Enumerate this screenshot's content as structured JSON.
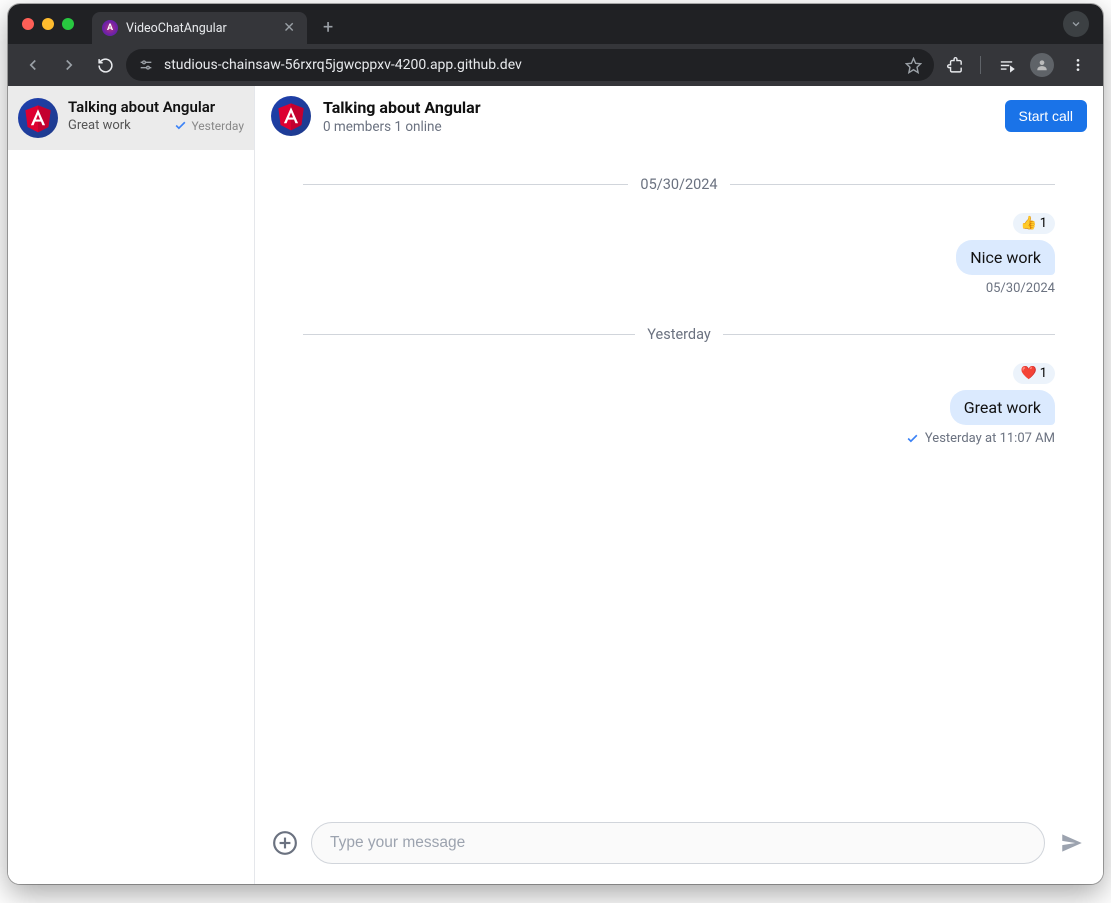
{
  "browser": {
    "tab_title": "VideoChatAngular",
    "url": "studious-chainsaw-56rxrq5jgwcppxv-4200.app.github.dev"
  },
  "sidebar": {
    "channel": {
      "name": "Talking about Angular",
      "preview": "Great work",
      "timestamp": "Yesterday"
    }
  },
  "header": {
    "title": "Talking about Angular",
    "subtitle": "0 members 1 online",
    "call_button": "Start call"
  },
  "messages": {
    "sep1": "05/30/2024",
    "msg1": {
      "reaction_emoji": "👍",
      "reaction_count": "1",
      "text": "Nice work",
      "timestamp": "05/30/2024"
    },
    "sep2": "Yesterday",
    "msg2": {
      "reaction_emoji": "❤️",
      "reaction_count": "1",
      "text": "Great work",
      "timestamp": "Yesterday at 11:07 AM"
    }
  },
  "composer": {
    "placeholder": "Type your message"
  }
}
